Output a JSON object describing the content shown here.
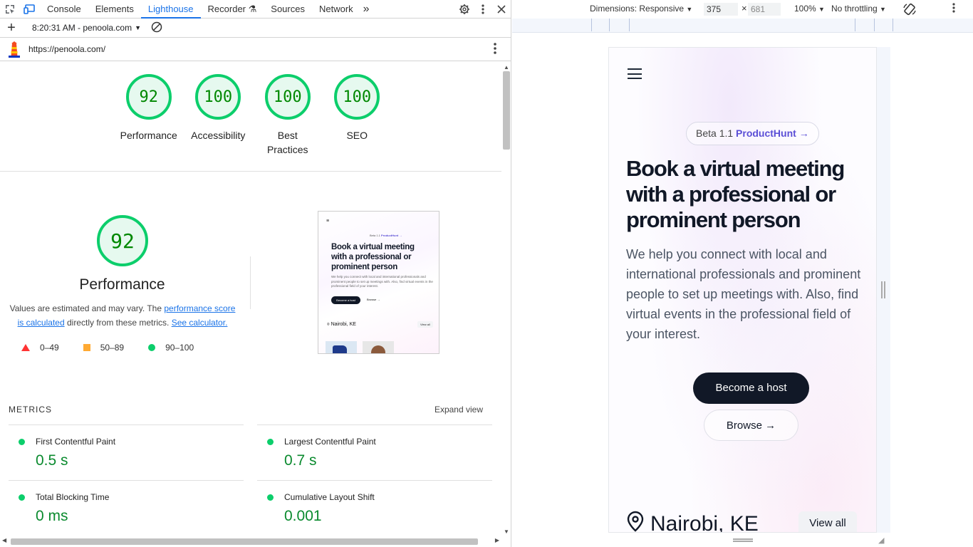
{
  "devtools": {
    "tabs": [
      "Console",
      "Elements",
      "Lighthouse",
      "Recorder",
      "Sources",
      "Network"
    ],
    "active_tab": "Lighthouse",
    "more_tabs": "»",
    "report_time": "8:20:31 AM - penoola.com",
    "url": "https://penoola.com/"
  },
  "scores": [
    {
      "label": "Performance",
      "value": "92"
    },
    {
      "label": "Accessibility",
      "value": "100"
    },
    {
      "label": "Best Practices",
      "value": "100"
    },
    {
      "label": "SEO",
      "value": "100"
    }
  ],
  "performance": {
    "score": "92",
    "title": "Performance",
    "desc_prefix": "Values are estimated and may vary. The ",
    "desc_link1": "performance score is calculated",
    "desc_middle": " directly from these metrics. ",
    "desc_link2": "See calculator.",
    "legend": [
      "0–49",
      "50–89",
      "90–100"
    ]
  },
  "thumbnail": {
    "beta": "Beta 1.1",
    "beta_link": "ProductHunt →",
    "title": "Book a virtual meeting with a professional or prominent person",
    "sub": "We help you connect with local and international professionals and prominent people to set up meetings with. Also, find virtual events in the professional field of your interest.",
    "host": "Become a host",
    "browse": "Browse →",
    "location": "Nairobi, KE",
    "view_all": "View all"
  },
  "metrics": {
    "heading": "METRICS",
    "expand": "Expand view",
    "items": [
      {
        "name": "First Contentful Paint",
        "value": "0.5 s"
      },
      {
        "name": "Largest Contentful Paint",
        "value": "0.7 s"
      },
      {
        "name": "Total Blocking Time",
        "value": "0 ms"
      },
      {
        "name": "Cumulative Layout Shift",
        "value": "0.001"
      }
    ]
  },
  "emulation": {
    "dimensions": "Dimensions: Responsive",
    "width": "375",
    "times": "×",
    "height": "681",
    "zoom": "100%",
    "throttling": "No throttling"
  },
  "page": {
    "beta": "Beta 1.1",
    "beta_link": "ProductHunt →",
    "title": "Book a virtual meeting with a professional or prominent person",
    "subtitle": "We help you connect with local and international professionals and prominent people to set up meetings with. Also, find virtual events in the professional field of your interest.",
    "host_button": "Become a host",
    "browse_button": "Browse →",
    "location": "Nairobi, KE",
    "view_all": "View all"
  },
  "colors": {
    "accent": "#1a73e8",
    "pass": "#0cce6b",
    "brand_dark": "#111827",
    "product_hunt": "#5b4fd6"
  }
}
